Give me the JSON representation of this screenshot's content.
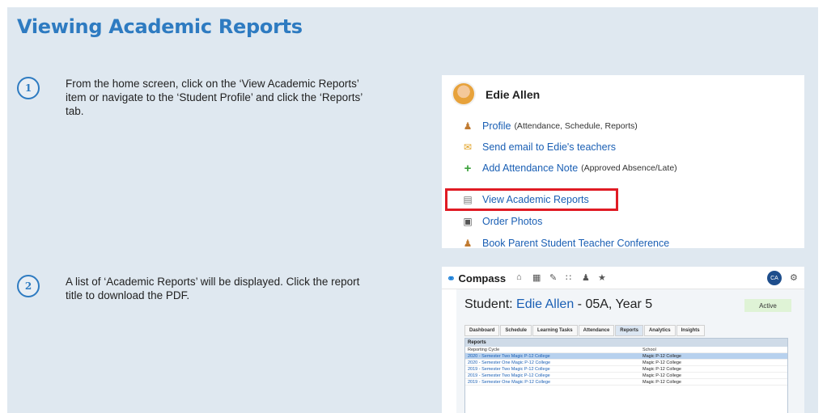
{
  "title": "Viewing Academic Reports",
  "steps": [
    {
      "num": "1",
      "text": "From the home screen, click on the ‘View Academic Reports’ item or navigate to the ‘Student Profile’ and click the ‘Reports’ tab."
    },
    {
      "num": "2",
      "text": "A list of ‘Academic Reports’ will be displayed. Click the report title to download the PDF."
    }
  ],
  "profile_panel": {
    "name": "Edie Allen",
    "items": [
      {
        "label": "Profile",
        "sub": "(Attendance, Schedule, Reports)",
        "icon": "user-icon"
      },
      {
        "label": "Send email to Edie's teachers",
        "sub": "",
        "icon": "envelope-icon"
      },
      {
        "label": "Add Attendance Note",
        "sub": "(Approved Absence/Late)",
        "icon": "plus-icon"
      },
      {
        "label": "View Academic Reports",
        "sub": "",
        "icon": "report-icon"
      },
      {
        "label": "Order Photos",
        "sub": "",
        "icon": "camera-icon"
      },
      {
        "label": "Book Parent Student Teacher Conference",
        "sub": "",
        "icon": "people-icon"
      }
    ]
  },
  "compass_panel": {
    "logo": "Compass",
    "avatar_initials": "CA",
    "student_prefix": "Student: ",
    "student_name": "Edie Allen",
    "student_suffix": " - 05A, Year 5",
    "status": "Active",
    "tabs": [
      "Dashboard",
      "Schedule",
      "Learning Tasks",
      "Attendance",
      "Reports",
      "Analytics",
      "Insights"
    ],
    "active_tab": "Reports",
    "reports_title": "Reports",
    "columns": [
      "Reporting Cycle",
      "School"
    ],
    "rows": [
      {
        "cycle": "2020 - Semester Two Magic P-12 College",
        "school": "Magic P-12 College"
      },
      {
        "cycle": "2020 - Semester One Magic P-12 College",
        "school": "Magic P-12 College"
      },
      {
        "cycle": "2019 - Semester Two Magic P-12 College",
        "school": "Magic P-12 College"
      },
      {
        "cycle": "2019 - Semester Two Magic P-12 College",
        "school": "Magic P-12 College"
      },
      {
        "cycle": "2019 - Semester One Magic P-12 College",
        "school": "Magic P-12 College"
      }
    ]
  }
}
